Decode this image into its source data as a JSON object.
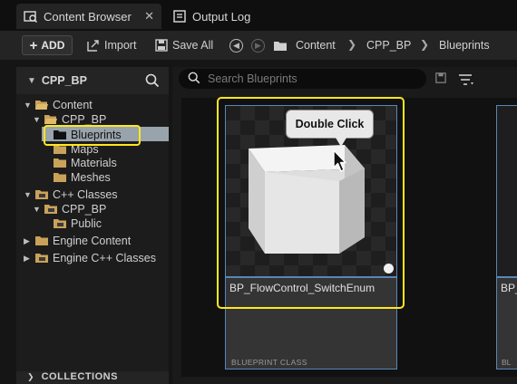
{
  "tabs": [
    {
      "label": "Content Browser",
      "icon": "content-browser-icon",
      "close": "✕",
      "active": true
    },
    {
      "label": "Output Log",
      "icon": "output-log-icon",
      "active": false
    }
  ],
  "toolbar": {
    "add_label": "ADD",
    "import_label": "Import",
    "save_all_label": "Save All"
  },
  "breadcrumb": [
    "Content",
    "CPP_BP",
    "Blueprints"
  ],
  "left_panel": {
    "header": "CPP_BP",
    "tree": [
      {
        "label": "Content",
        "level": 0
      },
      {
        "label": "CPP_BP",
        "level": 1
      },
      {
        "label": "Blueprints",
        "level": 2,
        "selected": true
      },
      {
        "label": "Maps",
        "level": 2
      },
      {
        "label": "Materials",
        "level": 2
      },
      {
        "label": "Meshes",
        "level": 2
      },
      {
        "label": "C++ Classes",
        "level": 0
      },
      {
        "label": "CPP_BP",
        "level": 1
      },
      {
        "label": "Public",
        "level": 2
      },
      {
        "label": "Engine Content",
        "level": 0
      },
      {
        "label": "Engine C++ Classes",
        "level": 0
      }
    ],
    "collections_label": "COLLECTIONS"
  },
  "search": {
    "placeholder": "Search Blueprints"
  },
  "assets": [
    {
      "name": "BP_FlowControl_SwitchEnum",
      "class_label": "BLUEPRINT CLASS"
    },
    {
      "name": "BP_",
      "class_label": "BL"
    }
  ],
  "tooltip": "Double Click",
  "colors": {
    "highlight": "#ffe81c",
    "selection": "#98a3ab",
    "asset_border": "#5a86b8",
    "folder": "#c9a25a"
  }
}
